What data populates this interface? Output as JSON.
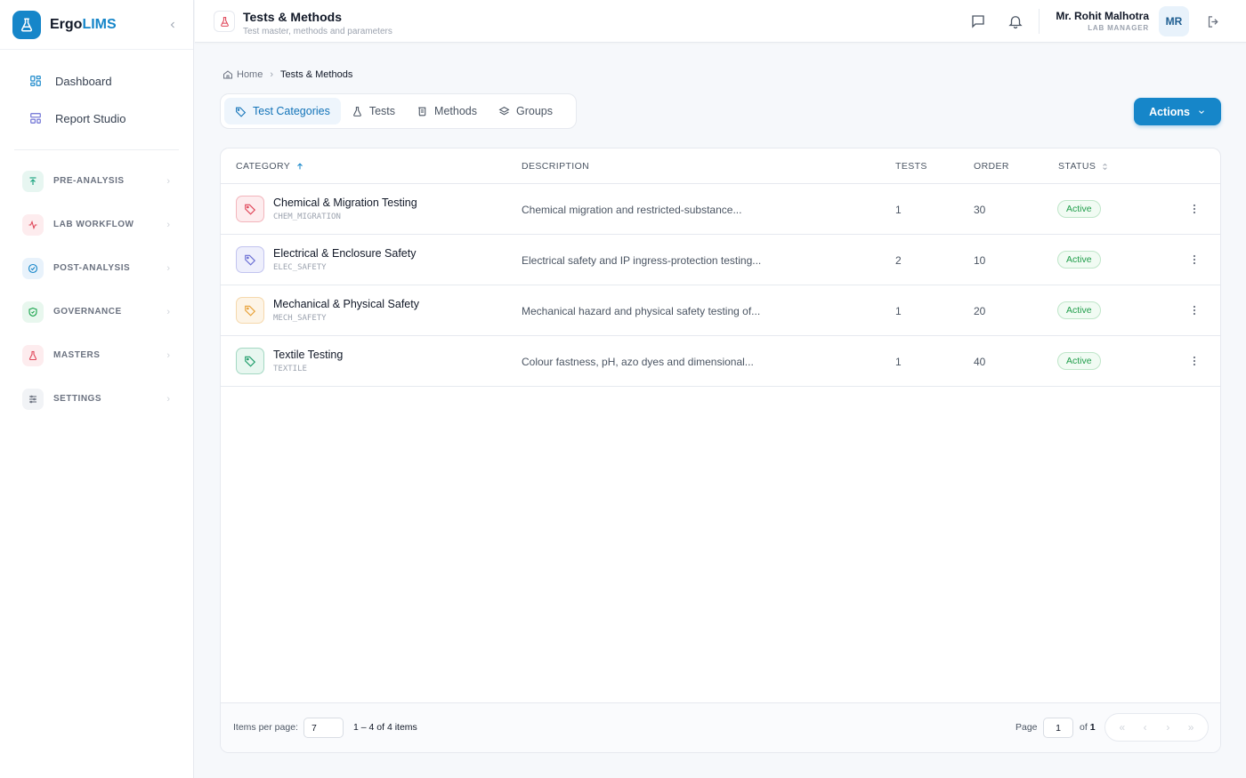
{
  "app": {
    "brand_prefix": "Ergo",
    "brand_accent": "LIMS",
    "brand_color": "#1686c9"
  },
  "sidebar": {
    "links": [
      {
        "label": "Dashboard",
        "icon": "dashboard-icon"
      },
      {
        "label": "Report Studio",
        "icon": "report-icon"
      }
    ],
    "groups": [
      {
        "label": "PRE-ANALYSIS",
        "icon": "arrow-up-icon",
        "color": "#12a07a"
      },
      {
        "label": "LAB WORKFLOW",
        "icon": "activity-icon",
        "color": "#e0475a"
      },
      {
        "label": "POST-ANALYSIS",
        "icon": "check-circle-icon",
        "color": "#1686c9"
      },
      {
        "label": "GOVERNANCE",
        "icon": "shield-icon",
        "color": "#16a34a"
      },
      {
        "label": "MASTERS",
        "icon": "flask-icon",
        "color": "#e0475a"
      },
      {
        "label": "SETTINGS",
        "icon": "sliders-icon",
        "color": "#6b7280"
      }
    ]
  },
  "header": {
    "title": "Tests & Methods",
    "subtitle": "Test master, methods and parameters",
    "user_name": "Mr. Rohit Malhotra",
    "user_role": "LAB MANAGER",
    "avatar_initials": "MR"
  },
  "breadcrumb": {
    "home": "Home",
    "current": "Tests & Methods"
  },
  "tabs": [
    {
      "label": "Test Categories",
      "active": true
    },
    {
      "label": "Tests",
      "active": false
    },
    {
      "label": "Methods",
      "active": false
    },
    {
      "label": "Groups",
      "active": false
    }
  ],
  "actions_label": "Actions",
  "table": {
    "columns": {
      "category": "CATEGORY",
      "description": "DESCRIPTION",
      "tests": "TESTS",
      "order": "ORDER",
      "status": "STATUS"
    },
    "rows": [
      {
        "name": "Chemical & Migration Testing",
        "code": "CHEM_MIGRATION",
        "description": "Chemical migration and restricted-substance...",
        "tests": "1",
        "order": "30",
        "status": "Active",
        "icon_color": "#e0475a",
        "icon_bg": "#fdecee"
      },
      {
        "name": "Electrical & Enclosure Safety",
        "code": "ELEC_SAFETY",
        "description": "Electrical safety and IP ingress-protection testing...",
        "tests": "2",
        "order": "10",
        "status": "Active",
        "icon_color": "#6b6fd4",
        "icon_bg": "#eeeffc"
      },
      {
        "name": "Mechanical & Physical Safety",
        "code": "MECH_SAFETY",
        "description": "Mechanical hazard and physical safety testing of...",
        "tests": "1",
        "order": "20",
        "status": "Active",
        "icon_color": "#e8a23a",
        "icon_bg": "#fdf4e6"
      },
      {
        "name": "Textile Testing",
        "code": "TEXTILE",
        "description": "Colour fastness, pH, azo dyes and dimensional...",
        "tests": "1",
        "order": "40",
        "status": "Active",
        "icon_color": "#1f9d6a",
        "icon_bg": "#e8f7f0"
      }
    ]
  },
  "pagination": {
    "items_per_page_label": "Items per page:",
    "items_per_page": "7",
    "range_text": "1 – 4 of 4 items",
    "page_label": "Page",
    "current_page": "1",
    "of_label": "of",
    "total_pages": "1"
  }
}
